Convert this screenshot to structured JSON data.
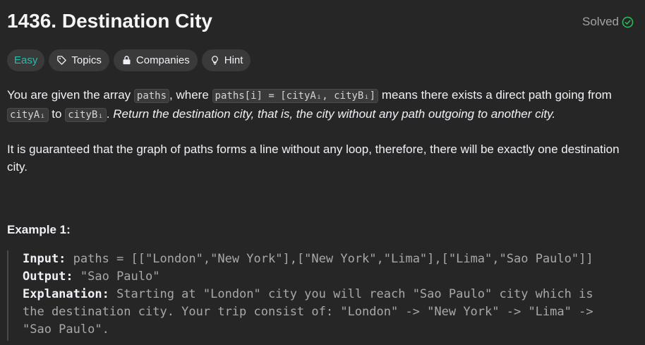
{
  "problem": {
    "title": "1436. Destination City",
    "status": "Solved",
    "difficulty": "Easy",
    "colors": {
      "easy": "#2cbbaa",
      "solved": "#2cbb5d"
    }
  },
  "tags": {
    "topics": "Topics",
    "companies": "Companies",
    "hint": "Hint"
  },
  "description": {
    "p1_a": "You are given the array ",
    "code_paths": "paths",
    "p1_b": ", where ",
    "code_paths_i": "paths[i] = [cityAᵢ, cityBᵢ]",
    "p1_c": " means there exists a direct path going from ",
    "code_cityA": "cityAᵢ",
    "p1_d": " to ",
    "code_cityB": "cityBᵢ",
    "p1_e": ". ",
    "p1_italic": "Return the destination city, that is, the city without any path outgoing to another city.",
    "p2": "It is guaranteed that the graph of paths forms a line without any loop, therefore, there will be exactly one destination city."
  },
  "example": {
    "title": "Example 1:",
    "input_label": "Input:",
    "input_value": " paths = [[\"London\",\"New York\"],[\"New York\",\"Lima\"],[\"Lima\",\"Sao Paulo\"]]",
    "output_label": "Output:",
    "output_value": " \"Sao Paulo\"",
    "explanation_label": "Explanation:",
    "explanation_line1": " Starting at \"London\" city you will reach \"Sao Paulo\" city which is",
    "explanation_line2": "the destination city. Your trip consist of: \"London\" -> \"New York\" -> \"Lima\" ->",
    "explanation_line3": "\"Sao Paulo\"."
  }
}
